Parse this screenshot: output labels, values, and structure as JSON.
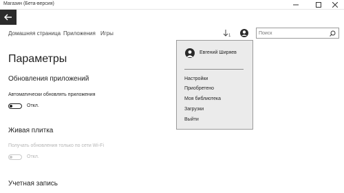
{
  "window": {
    "title": "Магазин (Бета-версия)"
  },
  "nav": {
    "home": "Домашняя страница",
    "apps": "Приложения",
    "games": "Игры"
  },
  "search": {
    "placeholder": "Поиск",
    "value": ""
  },
  "page": {
    "title": "Параметры"
  },
  "sections": {
    "app_updates": {
      "heading": "Обновления приложений",
      "auto_update_label": "Автоматически обновлять приложения",
      "auto_update_state": "Откл."
    },
    "live_tile": {
      "heading": "Живая плитка",
      "wifi_only_label": "Получать обновления только по сети Wi-Fi",
      "wifi_only_state": "Откл."
    },
    "account": {
      "heading": "Учетная запись"
    }
  },
  "account_menu": {
    "user_name": "Евгений Ширяев",
    "items": [
      "Настройки",
      "Приобретено",
      "Моя библиотека",
      "Загрузки",
      "Выйти"
    ]
  },
  "colors": {
    "accent_dark": "#2b2b2b",
    "menu_bg": "#ebebeb",
    "disabled_text": "#b5b5b5"
  },
  "icons": [
    "back-arrow-icon",
    "minimize-icon",
    "maximize-icon",
    "close-icon",
    "downloads-icon",
    "user-icon",
    "search-icon"
  ]
}
